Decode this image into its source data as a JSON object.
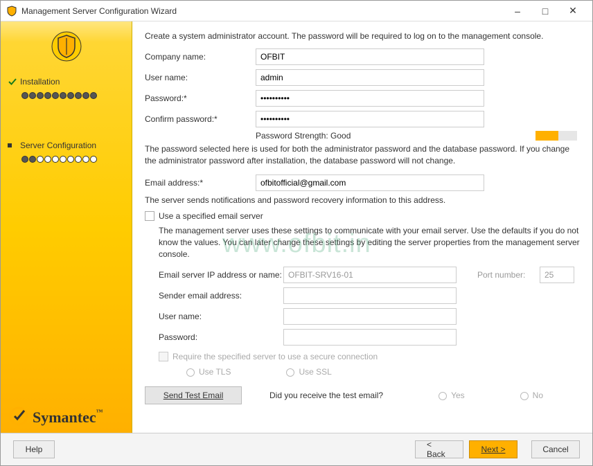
{
  "titlebar": {
    "title": "Management Server Configuration Wizard"
  },
  "sidebar": {
    "item_installation": "Installation",
    "item_server_config": "Server Configuration"
  },
  "main": {
    "intro": "Create a system administrator account. The password will be required to log on to the management console.",
    "company_label": "Company name:",
    "company_value": "OFBIT",
    "username_label": "User name:",
    "username_value": "admin",
    "password_label": "Password:*",
    "password_value": "••••••••••",
    "confirm_label": "Confirm password:*",
    "confirm_value": "••••••••••",
    "strength_label": "Password Strength: Good",
    "pw_note": "The password selected here is used for both the administrator password and the database password. If you change the administrator password after installation, the database password will not change.",
    "email_label": "Email address:*",
    "email_value": "ofbitofficial@gmail.com",
    "email_note": "The server sends notifications and password recovery information to this address.",
    "use_server_label": "Use a specified email server",
    "server_note": "The management server uses these settings to communicate with your email server.  Use the defaults if you do not know the values. You can later change these settings by editing the server properties from the management server console.",
    "srv_ip_label": "Email server IP address or name:",
    "srv_ip_value": "OFBIT-SRV16-01",
    "port_label": "Port number:",
    "port_value": "25",
    "sender_label": "Sender email address:",
    "srv_user_label": "User name:",
    "srv_pw_label": "Password:",
    "secure_label": "Require the specified server to use a secure connection",
    "tls_label": "Use TLS",
    "ssl_label": "Use SSL",
    "send_test": "Send Test Email",
    "test_q": "Did you receive the test email?",
    "yes": "Yes",
    "no": "No",
    "brand": "Symantec"
  },
  "footer": {
    "help": "Help",
    "back": "< Back",
    "next": "Next >",
    "cancel": "Cancel"
  },
  "watermark": "www.ofbit.in"
}
